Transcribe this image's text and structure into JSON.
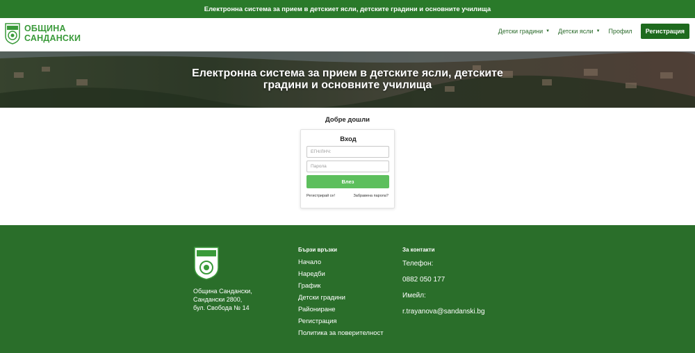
{
  "topbar": {
    "text": "Електронна система за прием в детскиет ясли, детските градини и основните училища"
  },
  "logo": {
    "line1": "ОБЩИНА",
    "line2": "САНДАНСКИ"
  },
  "nav": {
    "kindergartens": "Детски градини",
    "nurseries": "Детски ясли",
    "profile": "Профил",
    "register": "Регистрация"
  },
  "hero": {
    "title_line1": "Електронна система за прием в детските ясли, детските",
    "title_line2": "градини и основните училища"
  },
  "welcome": "Добре дошли",
  "login": {
    "title": "Вход",
    "id_placeholder": "ЕГН/ЛНЧ:",
    "password_placeholder": "Парола",
    "submit": "Влез",
    "register_link": "Регистрирай се!",
    "forgot_link": "Забравена парола?"
  },
  "footer": {
    "address": [
      "Община Сандански,",
      "Сандански 2800,",
      "бул. Свобода № 14"
    ],
    "quick_links_title": "Бързи връзки",
    "quick_links": [
      "Начало",
      "Наредби",
      "График",
      "Детски градини",
      "Райониране",
      "Регистрация",
      "Политика за поверителност"
    ],
    "contacts_title": "За контакти",
    "phone_label": "Телефон:",
    "phone": "0882 050 177",
    "email_label": "Имейл:",
    "email": "r.trayanova@sandanski.bg"
  },
  "colors": {
    "brand_green": "#2a7a2a",
    "button_green": "#5dbf5d",
    "footer_green": "#2a6e2a"
  }
}
